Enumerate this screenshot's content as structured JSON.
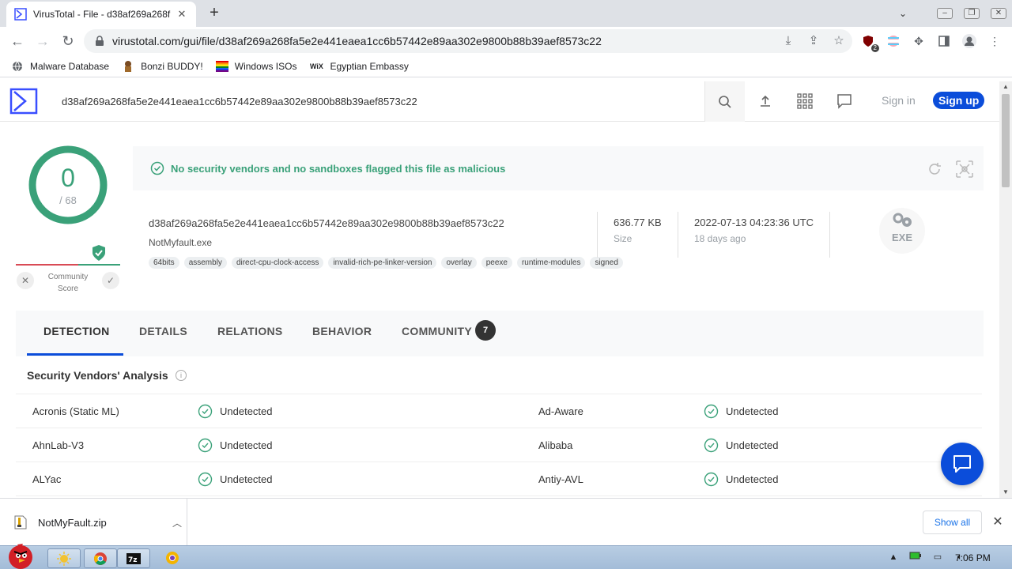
{
  "browser": {
    "tab_title": "VirusTotal - File - d38af269a268f",
    "url": "virustotal.com/gui/file/d38af269a268fa5e2e441eaea1cc6b57442e89aa302e9800b88b39aef8573c22",
    "extension_badge": "2",
    "bookmarks": [
      {
        "label": "Malware Database",
        "icon": "globe-icon"
      },
      {
        "label": "Bonzi BUDDY!",
        "icon": "bonzi-icon"
      },
      {
        "label": "Windows ISOs",
        "icon": "windows-flag-icon"
      },
      {
        "label": "Egyptian Embassy",
        "icon": "wix-icon",
        "icon_text": "WiX"
      }
    ]
  },
  "vt_header": {
    "search_value": "d38af269a268fa5e2e441eaea1cc6b57442e89aa302e9800b88b39aef8573c22",
    "signin_label": "Sign in",
    "signup_label": "Sign up"
  },
  "score": {
    "detections": "0",
    "total": "/ 68",
    "community_label_1": "Community",
    "community_label_2": "Score",
    "x_glyph": "✕",
    "check_glyph": "✓"
  },
  "banner": {
    "text": "No security vendors and no sandboxes flagged this file as malicious"
  },
  "file": {
    "hash": "d38af269a268fa5e2e441eaea1cc6b57442e89aa302e9800b88b39aef8573c22",
    "name": "NotMyfault.exe",
    "tags": [
      "64bits",
      "assembly",
      "direct-cpu-clock-access",
      "invalid-rich-pe-linker-version",
      "overlay",
      "peexe",
      "runtime-modules",
      "signed"
    ],
    "size_value": "636.77 KB",
    "size_label": "Size",
    "date_value": "2022-07-13 04:23:36 UTC",
    "date_label": "18 days ago",
    "type_label": "EXE"
  },
  "tabs": [
    {
      "label": "DETECTION",
      "active": true
    },
    {
      "label": "DETAILS"
    },
    {
      "label": "RELATIONS"
    },
    {
      "label": "BEHAVIOR"
    },
    {
      "label": "COMMUNITY",
      "count": "7"
    }
  ],
  "analysis": {
    "title": "Security Vendors' Analysis",
    "info_glyph": "i",
    "rows": [
      {
        "left_vendor": "Acronis (Static ML)",
        "left_status": "Undetected",
        "right_vendor": "Ad-Aware",
        "right_status": "Undetected"
      },
      {
        "left_vendor": "AhnLab-V3",
        "left_status": "Undetected",
        "right_vendor": "Alibaba",
        "right_status": "Undetected"
      },
      {
        "left_vendor": "ALYac",
        "left_status": "Undetected",
        "right_vendor": "Antiy-AVL",
        "right_status": "Undetected"
      }
    ]
  },
  "download": {
    "file_name": "NotMyFault.zip",
    "show_all_label": "Show all"
  },
  "taskbar": {
    "clock": "7:06 PM"
  },
  "colors": {
    "accent_blue": "#0b4dda",
    "clean_green": "#3aa179",
    "malicious_red": "#d94b55"
  }
}
